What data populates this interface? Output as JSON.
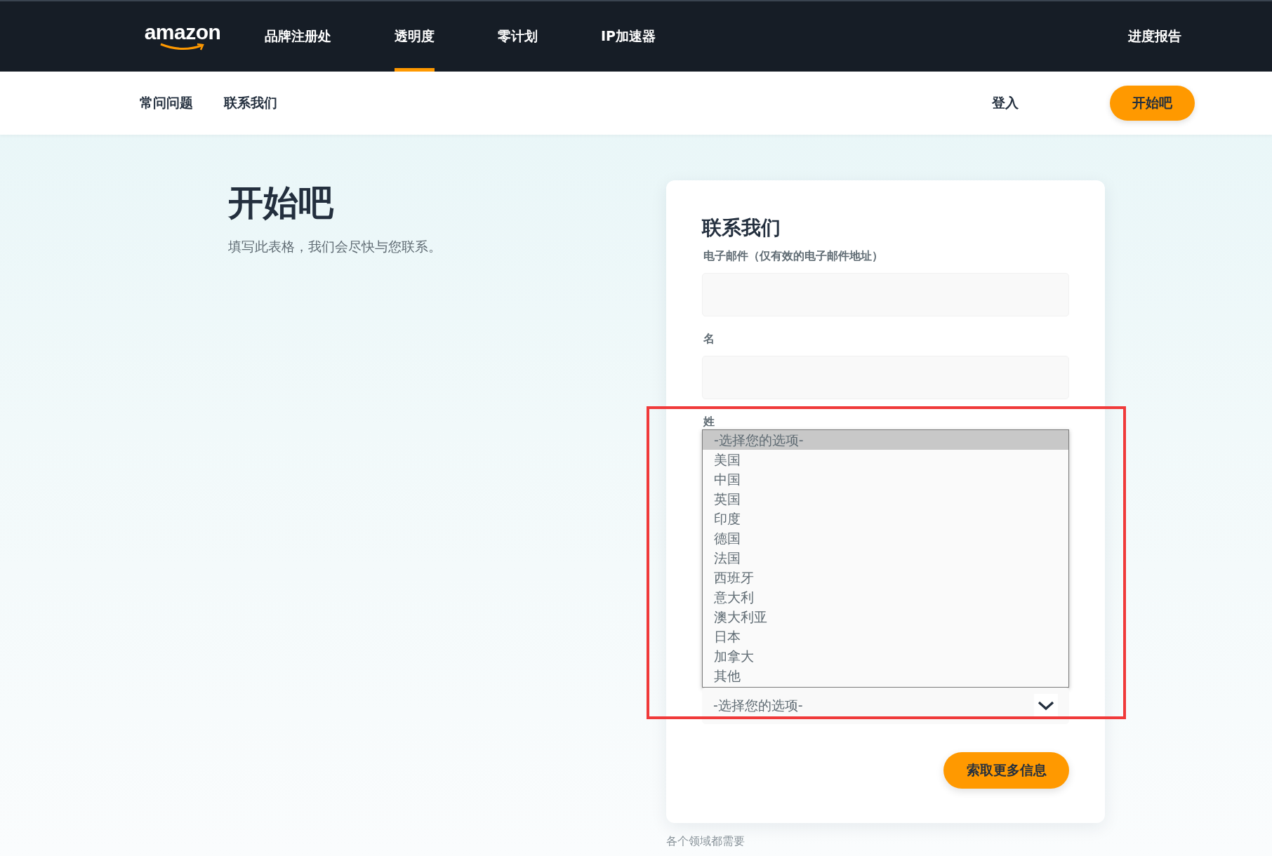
{
  "top_nav": {
    "logo": "amazon",
    "items": [
      {
        "label": "品牌注册处",
        "selected": false
      },
      {
        "label": "透明度",
        "selected": true
      },
      {
        "label": "零计划",
        "selected": false
      },
      {
        "label": "IP加速器",
        "selected": false
      }
    ],
    "right_link": "进度报告"
  },
  "sub_nav": {
    "items": [
      "常问问题",
      "联系我们"
    ],
    "sign_in": "登入",
    "cta": "开始吧"
  },
  "hero": {
    "title": "开始吧",
    "subtitle": "填写此表格，我们会尽快与您联系。"
  },
  "form": {
    "title": "联系我们",
    "fields": [
      {
        "kind": "text",
        "label": "电子邮件（仅有效的电子邮件地址）"
      },
      {
        "kind": "text",
        "label": "名"
      },
      {
        "kind": "select",
        "label": "姓",
        "value": "-选择您的选项-",
        "expanded": true,
        "options": [
          {
            "label": "-选择您的选项-",
            "selected": true
          },
          {
            "label": "美国",
            "selected": false
          },
          {
            "label": "中国",
            "selected": false
          },
          {
            "label": "英国",
            "selected": false
          },
          {
            "label": "印度",
            "selected": false
          },
          {
            "label": "德国",
            "selected": false
          },
          {
            "label": "法国",
            "selected": false
          },
          {
            "label": "西班牙",
            "selected": false
          },
          {
            "label": "意大利",
            "selected": false
          },
          {
            "label": "澳大利亚",
            "selected": false
          },
          {
            "label": "日本",
            "selected": false
          },
          {
            "label": "加拿大",
            "selected": false
          },
          {
            "label": "其他",
            "selected": false
          }
        ]
      }
    ],
    "submit": "索取更多信息"
  },
  "note": "各个领域都需要",
  "annotation": {
    "kind": "frame"
  }
}
